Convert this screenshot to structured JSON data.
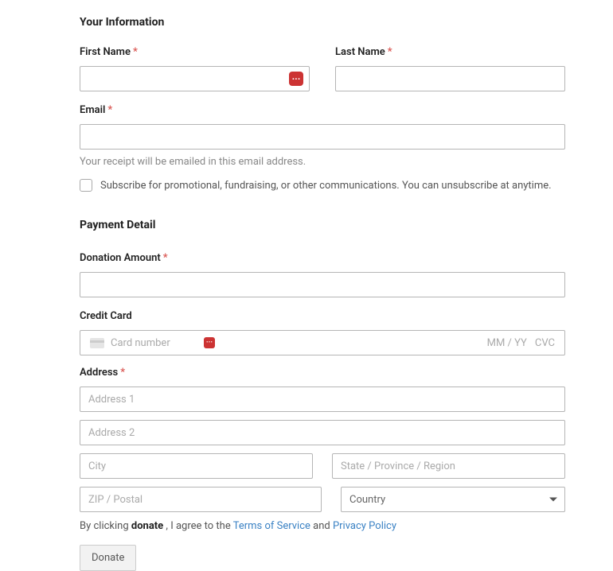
{
  "sections": {
    "info_heading": "Your Information",
    "payment_heading": "Payment Detail"
  },
  "labels": {
    "first_name": "First Name",
    "last_name": "Last Name",
    "email": "Email",
    "donation_amount": "Donation Amount",
    "credit_card": "Credit Card",
    "address": "Address",
    "required_mark": "*"
  },
  "email_hint": "Your receipt will be emailed in this email address.",
  "subscribe_text": "Subscribe for promotional, fundraising, or other communications. You can unsubscribe at anytime.",
  "cc": {
    "number_placeholder": "Card number",
    "expiry_placeholder": "MM / YY",
    "cvc_placeholder": "CVC"
  },
  "address": {
    "line1_placeholder": "Address 1",
    "line2_placeholder": "Address 2",
    "city_placeholder": "City",
    "state_placeholder": "State / Province / Region",
    "zip_placeholder": "ZIP / Postal",
    "country_placeholder": "Country"
  },
  "legal": {
    "prefix": "By clicking ",
    "donate_word": "donate",
    "middle": " , I agree to the ",
    "tos": "Terms of Service",
    "and": " and ",
    "privacy": "Privacy Policy"
  },
  "buttons": {
    "donate": "Donate"
  }
}
